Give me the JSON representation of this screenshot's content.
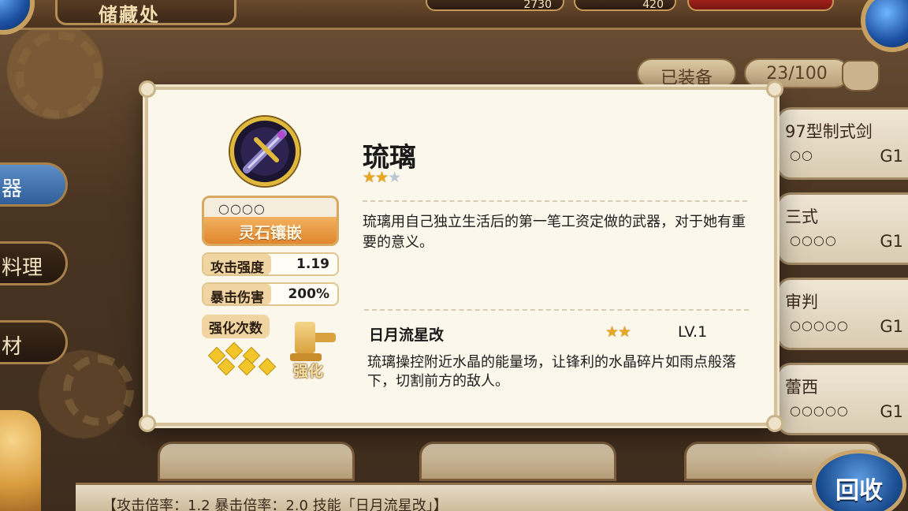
{
  "screen": {
    "title": "储藏处"
  },
  "currency": {
    "gold": "2730",
    "gems": "420"
  },
  "tabs": [
    {
      "label": "器",
      "active": true
    },
    {
      "label": "料理",
      "active": false
    },
    {
      "label": "材",
      "active": false
    }
  ],
  "header": {
    "equipped_label": "已装备",
    "capacity": "23/100"
  },
  "weapon_list": [
    {
      "name": "97型制式剑",
      "sockets": "○○",
      "grade": "G1"
    },
    {
      "name": "三式",
      "sockets": "○○○○",
      "grade": "G1"
    },
    {
      "name": "审判",
      "sockets": "○○○○○",
      "grade": "G1"
    },
    {
      "name": "蕾西",
      "sockets": "○○○○○",
      "grade": "G1"
    }
  ],
  "detail": {
    "name": "琉璃",
    "stars_filled": 2,
    "stars_total": 3,
    "sockets": "○○○○",
    "socket_button": "灵石镶嵌",
    "stats": [
      {
        "label": "攻击强度",
        "value": "1.19"
      },
      {
        "label": "暴击伤害",
        "value": "200%"
      }
    ],
    "enhance_label": "强化次数",
    "enhance_button": "强化",
    "description": "琉璃用自己独立生活后的第一笔工资定做的武器，对于她有重要的意义。",
    "skill": {
      "name": "日月流星改",
      "stars_filled": 2,
      "level": "LV.1",
      "description": "琉璃操控附近水晶的能量场，让锋利的水晶碎片如雨点般落下，切割前方的敌人。"
    }
  },
  "bottom_bar_text": "【攻击倍率：1.2 暴击倍率：2.0 技能「日月流星改」】",
  "recycle_button": "回收",
  "colors": {
    "accent_gold": "#e6a91e",
    "panel_bg": "#fbf7ea",
    "button_orange": "#e2862e"
  }
}
